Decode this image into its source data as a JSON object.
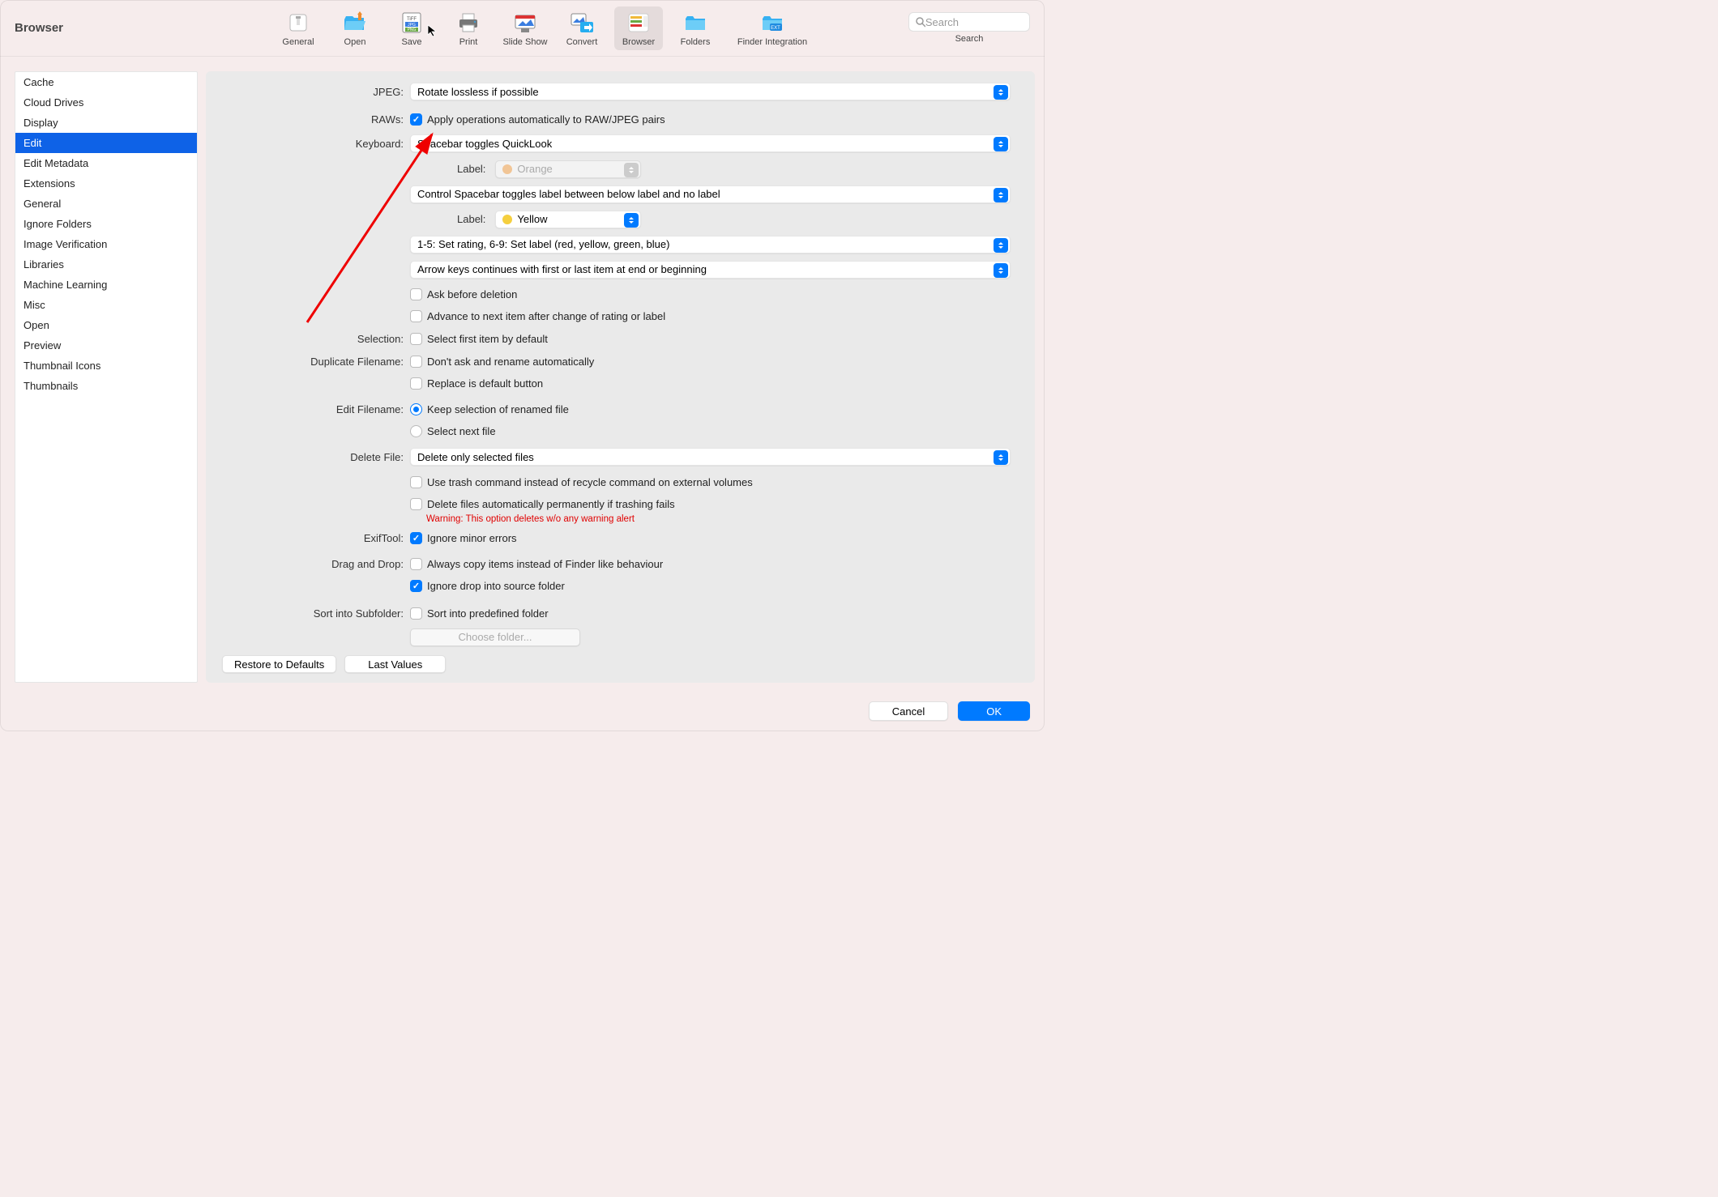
{
  "title": "Browser",
  "toolbar": [
    {
      "id": "general",
      "label": "General"
    },
    {
      "id": "open",
      "label": "Open"
    },
    {
      "id": "save",
      "label": "Save"
    },
    {
      "id": "print",
      "label": "Print"
    },
    {
      "id": "slideshow",
      "label": "Slide Show"
    },
    {
      "id": "convert",
      "label": "Convert"
    },
    {
      "id": "browser",
      "label": "Browser",
      "selected": true
    },
    {
      "id": "folders",
      "label": "Folders"
    },
    {
      "id": "finder",
      "label": "Finder Integration"
    }
  ],
  "search": {
    "placeholder": "Search",
    "caption": "Search"
  },
  "sidebar": [
    "Cache",
    "Cloud Drives",
    "Display",
    "Edit",
    "Edit Metadata",
    "Extensions",
    "General",
    "Ignore Folders",
    "Image Verification",
    "Libraries",
    "Machine Learning",
    "Misc",
    "Open",
    "Preview",
    "Thumbnail Icons",
    "Thumbnails"
  ],
  "sidebar_selected": 3,
  "form": {
    "jpeg_label": "JPEG:",
    "jpeg_value": "Rotate lossless if possible",
    "raws_label": "RAWs:",
    "raws_cb": "Apply operations automatically to RAW/JPEG pairs",
    "keyboard_label": "Keyboard:",
    "keyboard_value": "Spacebar toggles QuickLook",
    "label1_label": "Label:",
    "label1_value": "Orange",
    "label1_color": "#f1c596",
    "ctrl_value": "Control Spacebar toggles label between below label and no label",
    "label2_label": "Label:",
    "label2_value": "Yellow",
    "label2_color": "#f5cf3e",
    "rating_value": "1-5: Set rating, 6-9: Set label (red, yellow, green, blue)",
    "arrow_value": "Arrow keys continues with first or last item at end or beginning",
    "ask_before": "Ask before deletion",
    "advance": "Advance to next item after change of rating or label",
    "selection_label": "Selection:",
    "selection_cb": "Select first item by default",
    "dup_label": "Duplicate Filename:",
    "dup_cb": "Don't ask and rename automatically",
    "replace_cb": "Replace is default button",
    "editfn_label": "Edit Filename:",
    "editfn_r1": "Keep selection of renamed file",
    "editfn_r2": "Select next file",
    "delfile_label": "Delete File:",
    "delfile_value": "Delete only selected files",
    "trash_cb": "Use trash command instead of recycle command on external volumes",
    "delperm_cb": "Delete files automatically permanently if trashing fails",
    "warning": "Warning: This option deletes w/o any warning alert",
    "exif_label": "ExifTool:",
    "exif_cb": "Ignore minor errors",
    "dnd_label": "Drag  and Drop:",
    "dnd_cb1": "Always copy items instead of Finder like behaviour",
    "dnd_cb2": "Ignore drop into source folder",
    "sort_label": "Sort into Subfolder:",
    "sort_cb": "Sort into predefined folder",
    "choose_btn": "Choose folder...",
    "restore_btn": "Restore to Defaults",
    "last_btn": "Last Values"
  },
  "footer": {
    "cancel": "Cancel",
    "ok": "OK"
  }
}
